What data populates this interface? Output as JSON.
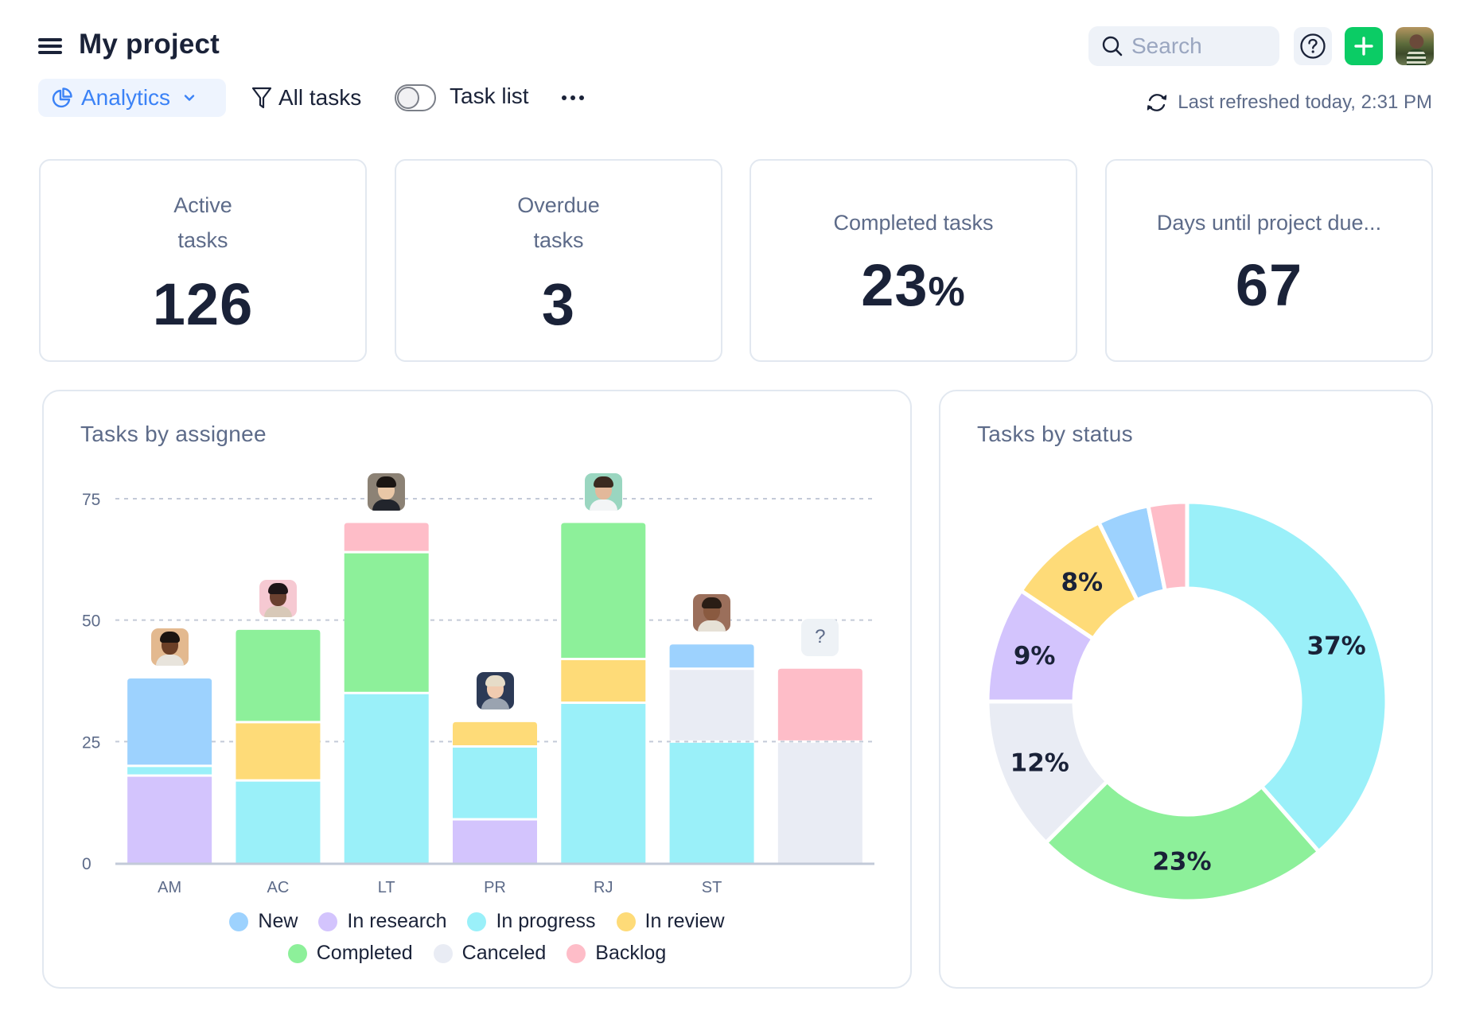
{
  "header": {
    "title": "My project",
    "view_selector": "Analytics",
    "filter_label": "All tasks",
    "toggle_label": "Task list",
    "toggle_on": false,
    "search_placeholder": "Search",
    "last_refreshed": "Last refreshed today, 2:31 PM"
  },
  "kpis": [
    {
      "label_line1": "Active",
      "label_line2": "tasks",
      "value": "126"
    },
    {
      "label_line1": "Overdue",
      "label_line2": "tasks",
      "value": "3"
    },
    {
      "label": "Completed tasks",
      "value": "23",
      "unit": "%"
    },
    {
      "label": "Days until project due...",
      "value": "67"
    }
  ],
  "statuses": [
    {
      "key": "new",
      "label": "New",
      "color": "#9DD2FE"
    },
    {
      "key": "research",
      "label": "In research",
      "color": "#D3C4FD"
    },
    {
      "key": "progress",
      "label": "In progress",
      "color": "#9AF0F9"
    },
    {
      "key": "review",
      "label": "In review",
      "color": "#FEDB78"
    },
    {
      "key": "completed",
      "label": "Completed",
      "color": "#8DF09A"
    },
    {
      "key": "canceled",
      "label": "Canceled",
      "color": "#E9ECF4"
    },
    {
      "key": "backlog",
      "label": "Backlog",
      "color": "#FEBDC8"
    }
  ],
  "chart_data": [
    {
      "type": "bar",
      "stacked": true,
      "title": "Tasks by assignee",
      "xlabel": "",
      "ylabel": "",
      "ylim": [
        0,
        75
      ],
      "yticks": [
        0,
        25,
        50,
        75
      ],
      "grid": true,
      "legend": "bottom",
      "categories": [
        "AM",
        "AC",
        "LT",
        "PR",
        "RJ",
        "ST",
        ""
      ],
      "category_avatars": [
        "person",
        "person",
        "person",
        "person",
        "person",
        "person",
        "unassigned"
      ],
      "unassigned_glyph": "?",
      "stack_order": [
        "research",
        "progress",
        "review",
        "completed",
        "canceled",
        "new",
        "backlog"
      ],
      "series": [
        {
          "name": "New",
          "key": "new",
          "values": [
            18,
            0,
            0,
            0,
            0,
            5,
            0
          ]
        },
        {
          "name": "In research",
          "key": "research",
          "values": [
            18,
            0,
            0,
            9,
            0,
            0,
            0
          ]
        },
        {
          "name": "In progress",
          "key": "progress",
          "values": [
            2,
            17,
            35,
            15,
            33,
            25,
            0
          ]
        },
        {
          "name": "In review",
          "key": "review",
          "values": [
            0,
            12,
            0,
            5,
            9,
            0,
            0
          ]
        },
        {
          "name": "Completed",
          "key": "completed",
          "values": [
            0,
            19,
            29,
            0,
            28,
            0,
            0
          ]
        },
        {
          "name": "Canceled",
          "key": "canceled",
          "values": [
            0,
            0,
            0,
            0,
            0,
            15,
            25
          ]
        },
        {
          "name": "Backlog",
          "key": "backlog",
          "values": [
            0,
            0,
            6,
            0,
            0,
            0,
            15
          ]
        }
      ]
    },
    {
      "type": "pie",
      "donut": true,
      "title": "Tasks by status",
      "start": "top",
      "direction": "clockwise",
      "slices": [
        {
          "name": "In progress",
          "key": "progress",
          "value": 37,
          "label": "37%"
        },
        {
          "name": "Completed",
          "key": "completed",
          "value": 23,
          "label": "23%"
        },
        {
          "name": "Canceled",
          "key": "canceled",
          "value": 12,
          "label": "12%"
        },
        {
          "name": "In research",
          "key": "research",
          "value": 9,
          "label": "9%"
        },
        {
          "name": "In review",
          "key": "review",
          "value": 8,
          "label": "8%"
        },
        {
          "name": "New",
          "key": "new",
          "value": 4,
          "label": ""
        },
        {
          "name": "Backlog",
          "key": "backlog",
          "value": 3,
          "label": ""
        }
      ]
    }
  ],
  "colors": {
    "accent": "#3B82F6",
    "add_button": "#0BCC65",
    "text_primary": "#1a2238",
    "text_secondary": "#5D6B89"
  }
}
